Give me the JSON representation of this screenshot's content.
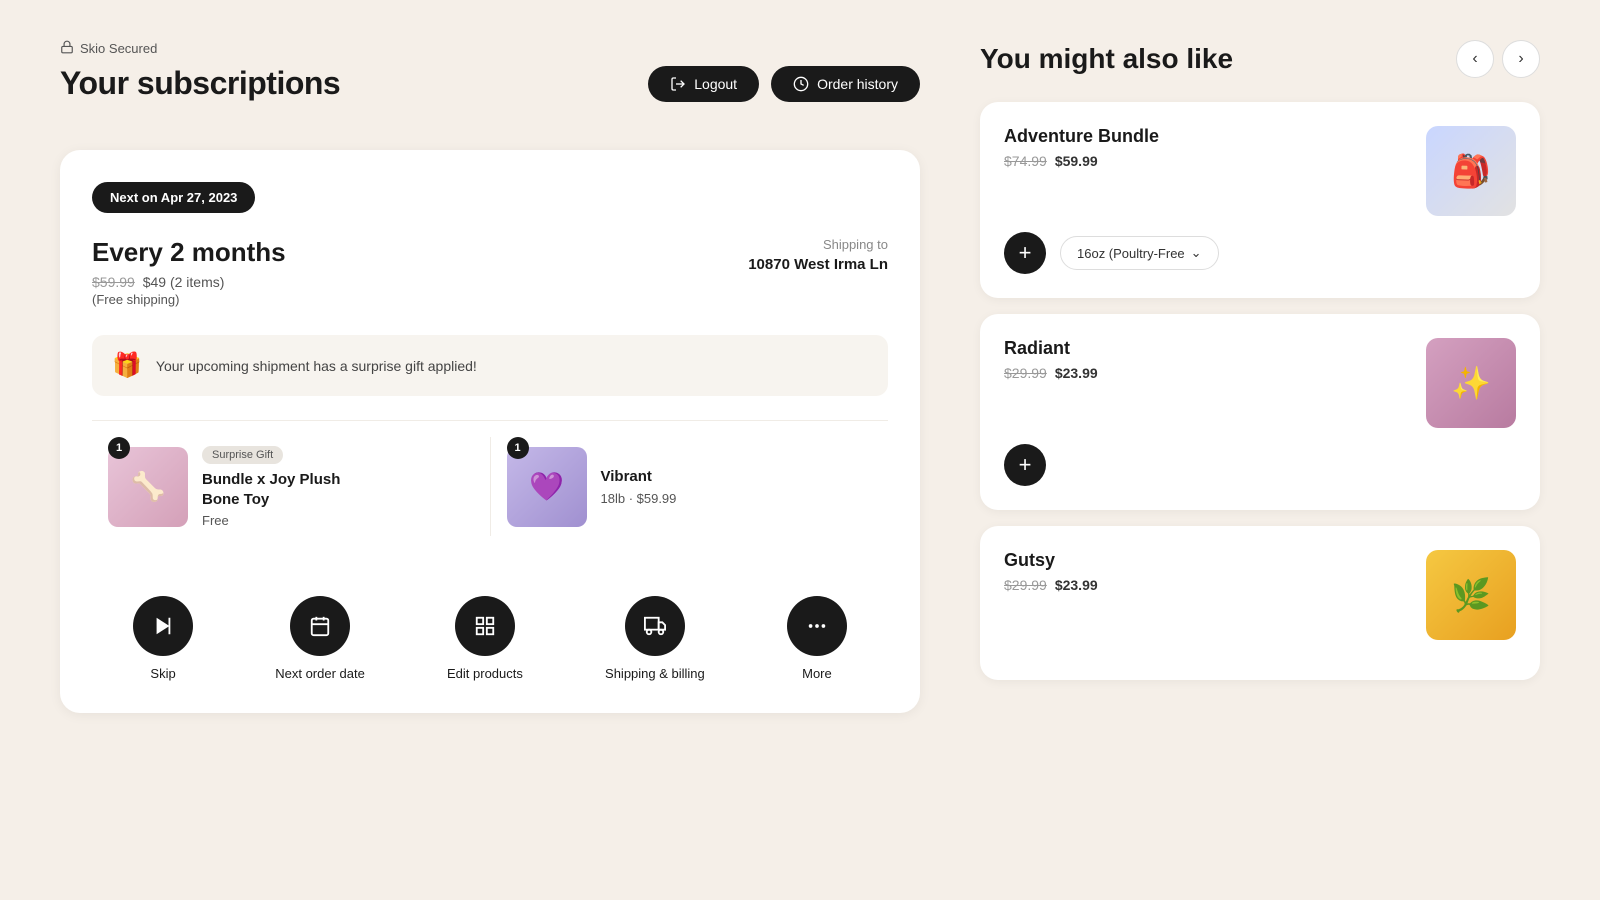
{
  "header": {
    "secured": "Skio Secured",
    "title": "Your subscriptions",
    "logout_label": "Logout",
    "order_history_label": "Order history"
  },
  "subscription": {
    "next_date_badge": "Next on Apr 27, 2023",
    "frequency": "Every 2 months",
    "original_price": "$59.99",
    "current_price": "$49",
    "items_count": "(2 items)",
    "free_shipping": "(Free shipping)",
    "shipping_label": "Shipping to",
    "shipping_address": "10870 West Irma Ln",
    "gift_notice": "Your upcoming shipment has a surprise gift applied!",
    "products": [
      {
        "badge": "1",
        "surprise_label": "Surprise Gift",
        "name": "Bundle x Joy Plush Bone Toy",
        "price": "Free",
        "image_type": "plush"
      },
      {
        "badge": "1",
        "name": "Vibrant",
        "details": "18lb · $59.99",
        "image_type": "vibrant"
      }
    ],
    "actions": [
      {
        "id": "skip",
        "label": "Skip",
        "icon": "skip"
      },
      {
        "id": "next-order-date",
        "label": "Next order date",
        "icon": "calendar"
      },
      {
        "id": "edit-products",
        "label": "Edit products",
        "icon": "grid"
      },
      {
        "id": "shipping-billing",
        "label": "Shipping & billing",
        "icon": "truck"
      },
      {
        "id": "more",
        "label": "More",
        "icon": "dots"
      }
    ]
  },
  "upsell": {
    "title": "You might also like",
    "products": [
      {
        "name": "Adventure Bundle",
        "old_price": "$74.99",
        "new_price": "$59.99",
        "variant": "16oz (Poultry-Free",
        "image_type": "adventure"
      },
      {
        "name": "Radiant",
        "old_price": "$29.99",
        "new_price": "$23.99",
        "image_type": "radiant"
      },
      {
        "name": "Gutsy",
        "old_price": "$29.99",
        "new_price": "$23.99",
        "image_type": "gutsy"
      }
    ]
  }
}
